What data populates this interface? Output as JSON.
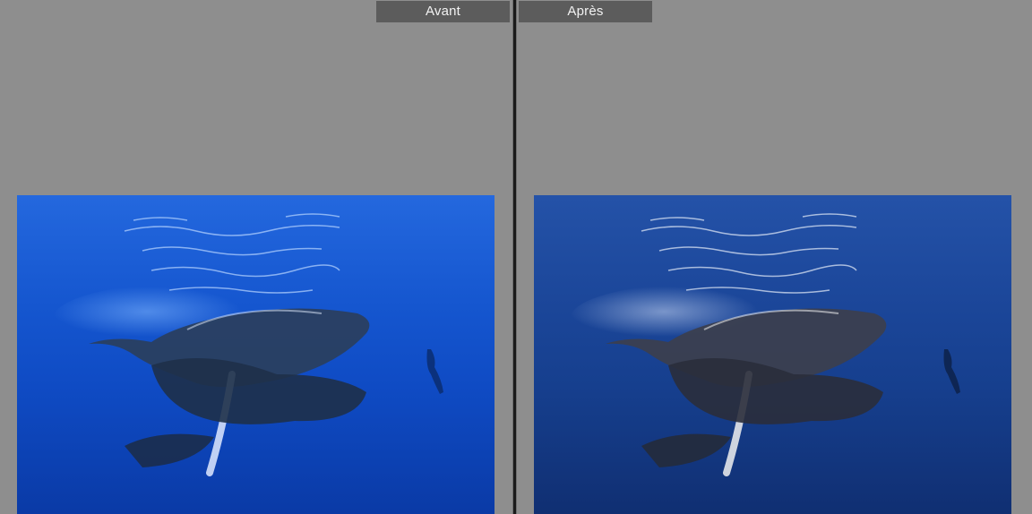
{
  "compare_view": {
    "before": {
      "label": "Avant",
      "image": {
        "subject": "humpback-whales-underwater",
        "water_top": "#1a5fd6",
        "water_mid": "#0f4bc4",
        "water_bottom": "#0a39a8"
      }
    },
    "after": {
      "label": "Après",
      "image": {
        "subject": "humpback-whales-underwater",
        "water_top": "#1c4fa8",
        "water_mid": "#163f8e",
        "water_bottom": "#102f72"
      }
    }
  }
}
